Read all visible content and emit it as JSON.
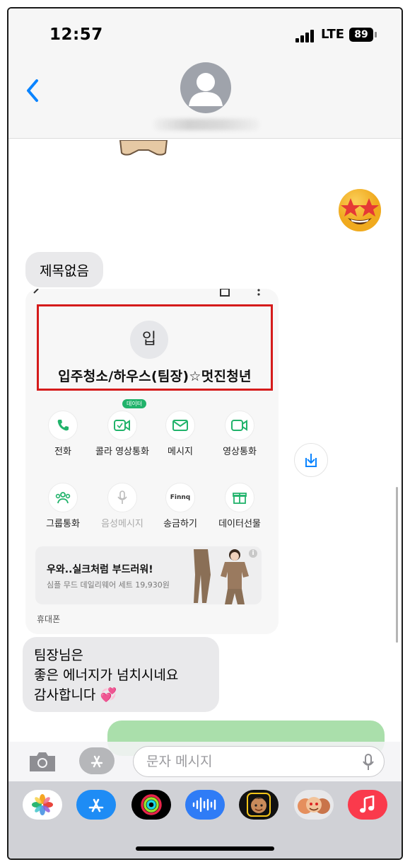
{
  "status_bar": {
    "time": "12:57",
    "network": "LTE",
    "battery": "89"
  },
  "header": {
    "back_icon": "chevron-left-icon",
    "avatar_icon": "person-avatar-icon",
    "contact_name_hidden": true
  },
  "chat": {
    "reaction_emoji": "star-struck-emoji",
    "subject": "제목없음",
    "contact_card": {
      "initial": "입",
      "name": "입주청소/하우스(팀장)☆멋진청년",
      "badge": "데이터",
      "actions": [
        {
          "label": "전화",
          "icon": "phone-icon",
          "enabled": true
        },
        {
          "label": "콜라 영상통화",
          "icon": "video-call-icon",
          "enabled": true
        },
        {
          "label": "메시지",
          "icon": "envelope-icon",
          "enabled": true
        },
        {
          "label": "영상통화",
          "icon": "video-icon",
          "enabled": true
        },
        {
          "label": "그룹통화",
          "icon": "group-icon",
          "enabled": true
        },
        {
          "label": "음성메시지",
          "icon": "microphone-icon",
          "enabled": false
        },
        {
          "label": "송금하기",
          "icon": "finnq-icon",
          "icon_text": "Finnq",
          "enabled": true
        },
        {
          "label": "데이터선물",
          "icon": "gift-icon",
          "enabled": true
        }
      ],
      "ad": {
        "title": "우와..실크처럼 부드러워!",
        "subtitle": "심플 무드 데일리웨어 세트 19,930원",
        "info": "i"
      },
      "phone_label": "휴대폰"
    },
    "message": {
      "lines": [
        "팀장님은",
        "좋은 에너지가 넘치시네요",
        "감사합니다 💞"
      ]
    }
  },
  "input_bar": {
    "placeholder": "문자 메시지"
  },
  "app_drawer": [
    "photos-icon",
    "app-store-icon",
    "activity-icon",
    "audio-message-icon",
    "memoji-icon",
    "animoji-icon",
    "music-icon"
  ],
  "colors": {
    "accent_blue": "#0a84ff",
    "card_green": "#21b36b",
    "imessage_gray": "#e9e9eb",
    "highlight_red": "#d51b1b"
  }
}
